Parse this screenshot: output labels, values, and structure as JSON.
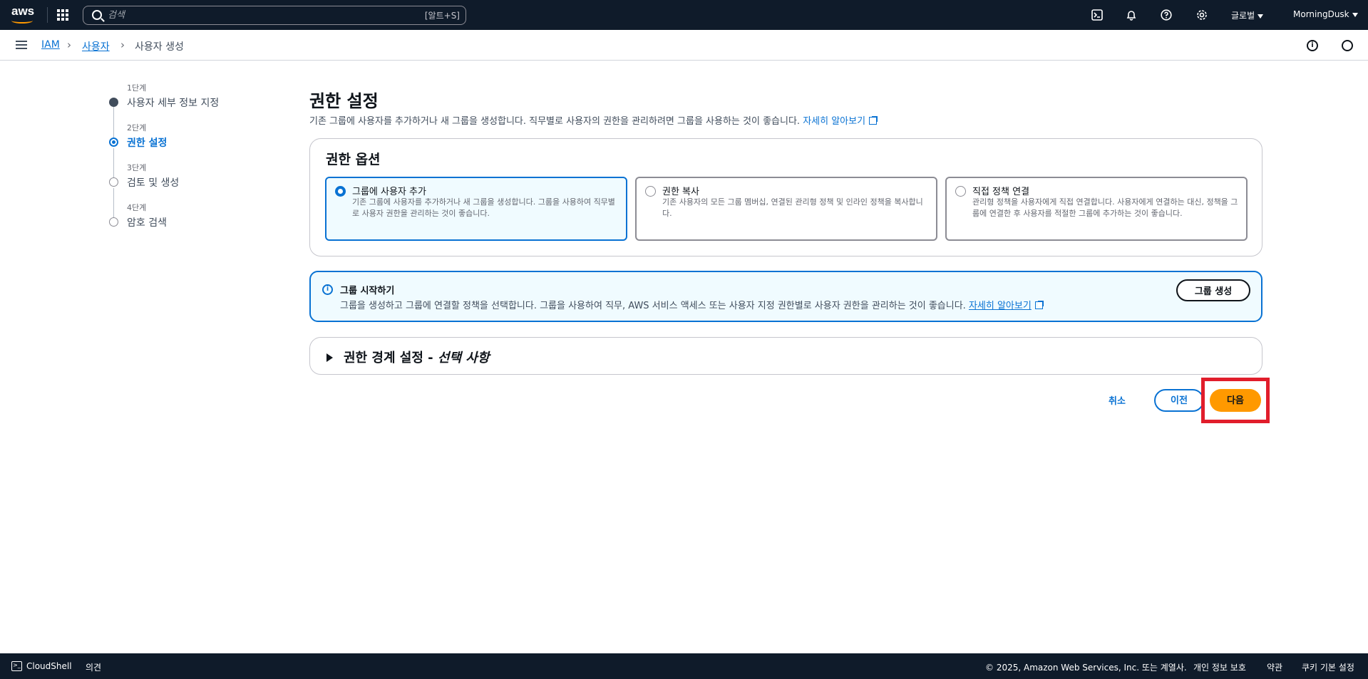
{
  "topnav": {
    "logo": "aws",
    "search_placeholder": "검색",
    "search_shortcut": "[알트+S]",
    "region": "글로벌",
    "account": "MorningDusk"
  },
  "breadcrumb": {
    "items": [
      "IAM",
      "사용자",
      "사용자 생성"
    ]
  },
  "steps": [
    {
      "label": "1단계",
      "title": "사용자 세부 정보 지정"
    },
    {
      "label": "2단계",
      "title": "권한 설정"
    },
    {
      "label": "3단계",
      "title": "검토 및 생성"
    },
    {
      "label": "4단계",
      "title": "암호 검색"
    }
  ],
  "main": {
    "title": "권한 설정",
    "description": "기존 그룹에 사용자를 추가하거나 새 그룹을 생성합니다. 직무별로 사용자의 권한을 관리하려면 그룹을 사용하는 것이 좋습니다.",
    "learn_more": "자세히 알아보기"
  },
  "permission_options": {
    "title": "권한 옵션",
    "options": [
      {
        "title": "그룹에 사용자 추가",
        "description": "기존 그룹에 사용자를 추가하거나 새 그룹을 생성합니다. 그룹을 사용하여 직무별로 사용자 권한을 관리하는 것이 좋습니다.",
        "selected": true
      },
      {
        "title": "권한 복사",
        "description": "기존 사용자의 모든 그룹 멤버십, 연결된 관리형 정책 및 인라인 정책을 복사합니다.",
        "selected": false
      },
      {
        "title": "직접 정책 연결",
        "description": "관리형 정책을 사용자에게 직접 연결합니다. 사용자에게 연결하는 대신, 정책을 그룹에 연결한 후 사용자를 적절한 그룹에 추가하는 것이 좋습니다.",
        "selected": false
      }
    ]
  },
  "info": {
    "title": "그룹 시작하기",
    "description": "그룹을 생성하고 그룹에 연결할 정책을 선택합니다. 그룹을 사용하여 직무, AWS 서비스 액세스 또는 사용자 지정 권한별로 사용자 권한을 관리하는 것이 좋습니다.",
    "learn_more": "자세히 알아보기",
    "button": "그룹 생성"
  },
  "boundary": {
    "title": "권한 경계 설정 - ",
    "optional": "선택 사항"
  },
  "actions": {
    "cancel": "취소",
    "previous": "이전",
    "next": "다음"
  },
  "footer": {
    "cloudshell": "CloudShell",
    "feedback": "의견",
    "copyright": "© 2025, Amazon Web Services, Inc. 또는 계열사.",
    "privacy": "개인 정보 보호",
    "terms": "약관",
    "cookies": "쿠키 기본 설정"
  },
  "colors": {
    "nav_bg": "#0f1b2a",
    "accent": "#0972d3",
    "primary_button": "#ff9900",
    "highlight": "#e11d2b"
  }
}
